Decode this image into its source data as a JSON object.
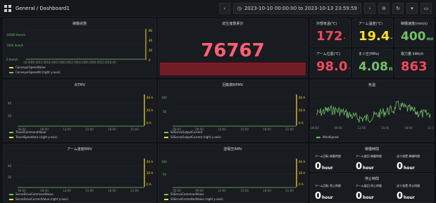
{
  "topbar": {
    "breadcrumb": "General / Dashboard1",
    "time_range": "2023-10-10 00:00:00 to 2023-10-13 23:59:59",
    "icons": [
      "apps-icon",
      "back-icon",
      "clock-icon",
      "forward-icon",
      "zoom-out-icon",
      "refresh-icon",
      "caret-down-icon",
      "monitor-icon"
    ]
  },
  "panels": {
    "top_left": {
      "title": "稼働状態",
      "y_left_ticks": [
        "10000 Item/h",
        "7000 Item/h",
        "0 Item/h"
      ],
      "y_right_ticks": [
        "60",
        "40",
        "20",
        "0"
      ],
      "x_ticks": [
        "00:00",
        "06:00",
        "12:00",
        "18:00",
        "00:00",
        "06:00",
        "12:00",
        "18:00",
        "00:00",
        "06:00",
        "12:00",
        "18:00"
      ],
      "legend": [
        "ConveyorSpeedValue",
        "ConveyorSpeedAll (right y-axis)"
      ]
    },
    "big_stat": {
      "title": "総生産数累計",
      "value": "76767"
    },
    "stats": [
      {
        "title": "外部気温(℃)",
        "value": "172",
        "unit": "·",
        "color": "#f2495c"
      },
      {
        "title": "アーム温度(℃)",
        "value": "19.4",
        "unit": "·",
        "color": "#fade2a"
      },
      {
        "title": "稼働速度(mm/s)",
        "value": "400",
        "unit": "mm",
        "color": "#73bf69"
      },
      {
        "title": "アーム位置(℃)",
        "value": "98.0",
        "unit": "·",
        "color": "#f2495c"
      },
      {
        "title": "まぐ圧(MPa)",
        "value": "4.08",
        "unit": "m",
        "color": "#73bf69"
      },
      {
        "title": "電力量 kWh/h",
        "value": "863",
        "unit": "",
        "color": "#f2495c"
      }
    ],
    "chart_a": {
      "title": "点TMV",
      "y_left_ticks": [
        "40",
        "20"
      ],
      "y_right_ticks": [
        "40 A",
        "20 A",
        "0 A"
      ],
      "x_ticks": [
        "06:00",
        "09:00",
        "12:00",
        "15:00",
        "18:00",
        "21:00"
      ],
      "legend": [
        "TravelCommandValue",
        "TravelSpeedAxis (right y-axis)"
      ]
    },
    "chart_b": {
      "title": "回転数RPMV",
      "y_left_ticks": [
        "100",
        "50"
      ],
      "y_right_ticks": [
        "40 A",
        "20 A",
        "0 A"
      ],
      "x_ticks": [
        "06:00",
        "09:00",
        "12:00",
        "15:00",
        "18:00",
        "21:00"
      ],
      "legend": [
        "SliServoOutputCurrent",
        "SliServoOutputCurrent (right y-axis)"
      ]
    },
    "chart_c": {
      "title": "気温",
      "x_ticks": [
        "06:00",
        "09:00",
        "12:00",
        "15:00",
        "18:00",
        "21:00"
      ],
      "legend": [
        "WindSpeed"
      ]
    },
    "chart_d": {
      "title": "アーム速度RMV",
      "y_left_ticks": [
        "40",
        "20"
      ],
      "y_right_ticks": [
        "40 A",
        "20 A",
        "0 A"
      ],
      "x_ticks": [
        "06:00",
        "09:00",
        "12:00",
        "15:00",
        "18:00",
        "21:00"
      ],
      "legend": [
        "ServoDriveCommandValue",
        "ServoDriveCurrentValue (right y-axis)"
      ]
    },
    "chart_e": {
      "title": "送電圧RMV",
      "y_left_ticks": [
        "100",
        "50"
      ],
      "y_right_ticks": [
        "40 A",
        "20 A",
        "0 A"
      ],
      "x_ticks": [
        "06:00",
        "09:00",
        "12:00",
        "15:00",
        "18:00",
        "21:00"
      ],
      "legend": [
        "SliServoCommandValue",
        "SliServoFormattedValue (right y-axis)"
      ]
    },
    "runtime_top": {
      "title": "稼働時間",
      "items": [
        {
          "label": "アーム回転 稼働時間",
          "value": "0",
          "unit": "hour"
        },
        {
          "label": "アーム旋回 稼働時間",
          "value": "0",
          "unit": "hour"
        },
        {
          "label": "送り装置 稼働時間",
          "value": "0",
          "unit": "hour"
        }
      ]
    },
    "runtime_bottom": {
      "title": "停止時間",
      "items": [
        {
          "label": "アーム回転 停止時間",
          "value": "0",
          "unit": "hour"
        },
        {
          "label": "アーム旋回 停止時間",
          "value": "0",
          "unit": "hour"
        },
        {
          "label": "送り装置 停止時間",
          "value": "0",
          "unit": "hour"
        }
      ]
    }
  },
  "colors": {
    "green": "#73bf69",
    "yellow": "#fade2a",
    "red": "#f2495c",
    "panel_bg": "#181b1f"
  }
}
